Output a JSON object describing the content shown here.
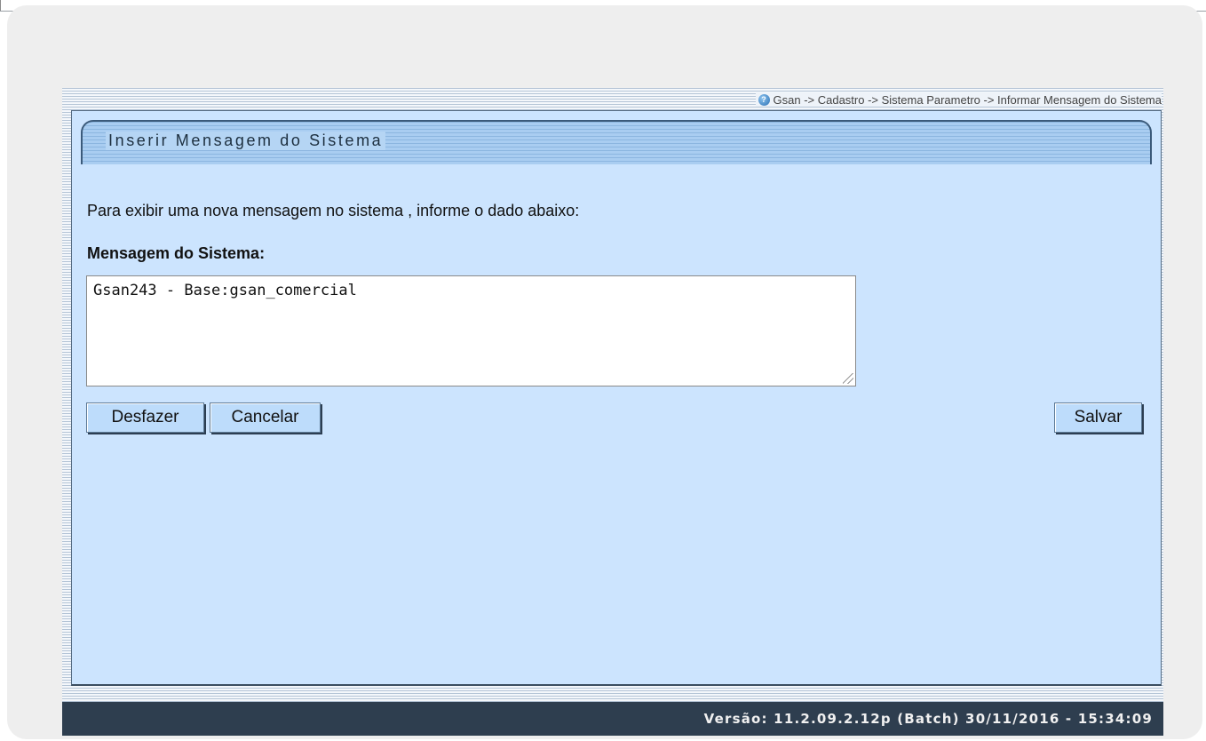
{
  "breadcrumb": {
    "icon": "help-icon",
    "text": "Gsan -> Cadastro -> Sistema Parametro -> Informar Mensagem do Sistema"
  },
  "panel": {
    "title": "Inserir Mensagem do Sistema",
    "instruction": "Para exibir uma nova mensagem no sistema , informe o dado abaixo:",
    "field_label": "Mensagem do Sistema:",
    "message_value": "Gsan243 - Base:gsan_comercial"
  },
  "buttons": {
    "undo": "Desfazer",
    "cancel": "Cancelar",
    "save": "Salvar"
  },
  "footer": {
    "version_text": "Versão: 11.2.09.2.12p (Batch) 30/11/2016 - 15:34:09"
  },
  "colors": {
    "panel_bg": "#cce4fe",
    "footer_bg": "#2e3e4f",
    "button_bg": "#bddcfb"
  }
}
